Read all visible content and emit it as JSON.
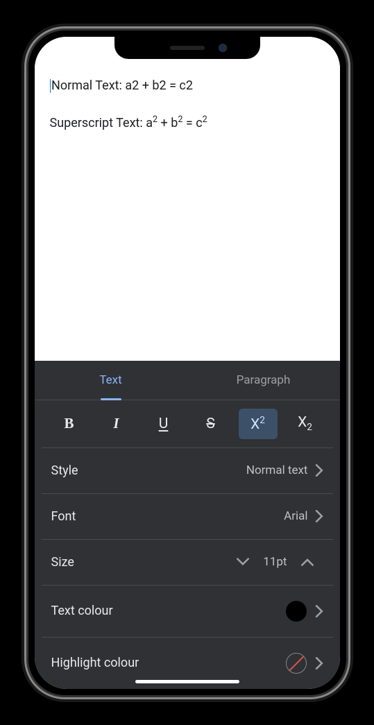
{
  "document": {
    "line1_prefix": "Normal Text: ",
    "line1_formula": "a2 + b2 = c2",
    "line2_prefix": "Superscript Text: ",
    "line2_a": "a",
    "line2_a_sup": "2",
    "line2_mid1": " + b",
    "line2_b_sup": "2",
    "line2_mid2": " = c",
    "line2_c_sup": "2"
  },
  "tabs": {
    "text": "Text",
    "paragraph": "Paragraph"
  },
  "format_buttons": {
    "bold": "B",
    "italic": "I",
    "underline": "U",
    "strike": "S",
    "superscript_base": "X",
    "superscript_sup": "2",
    "subscript_base": "X",
    "subscript_sub": "2"
  },
  "settings": {
    "style_label": "Style",
    "style_value": "Normal text",
    "font_label": "Font",
    "font_value": "Arial",
    "size_label": "Size",
    "size_value": "11pt",
    "text_colour_label": "Text colour",
    "text_colour_value": "#000000",
    "highlight_colour_label": "Highlight colour",
    "highlight_colour_value": "none"
  }
}
